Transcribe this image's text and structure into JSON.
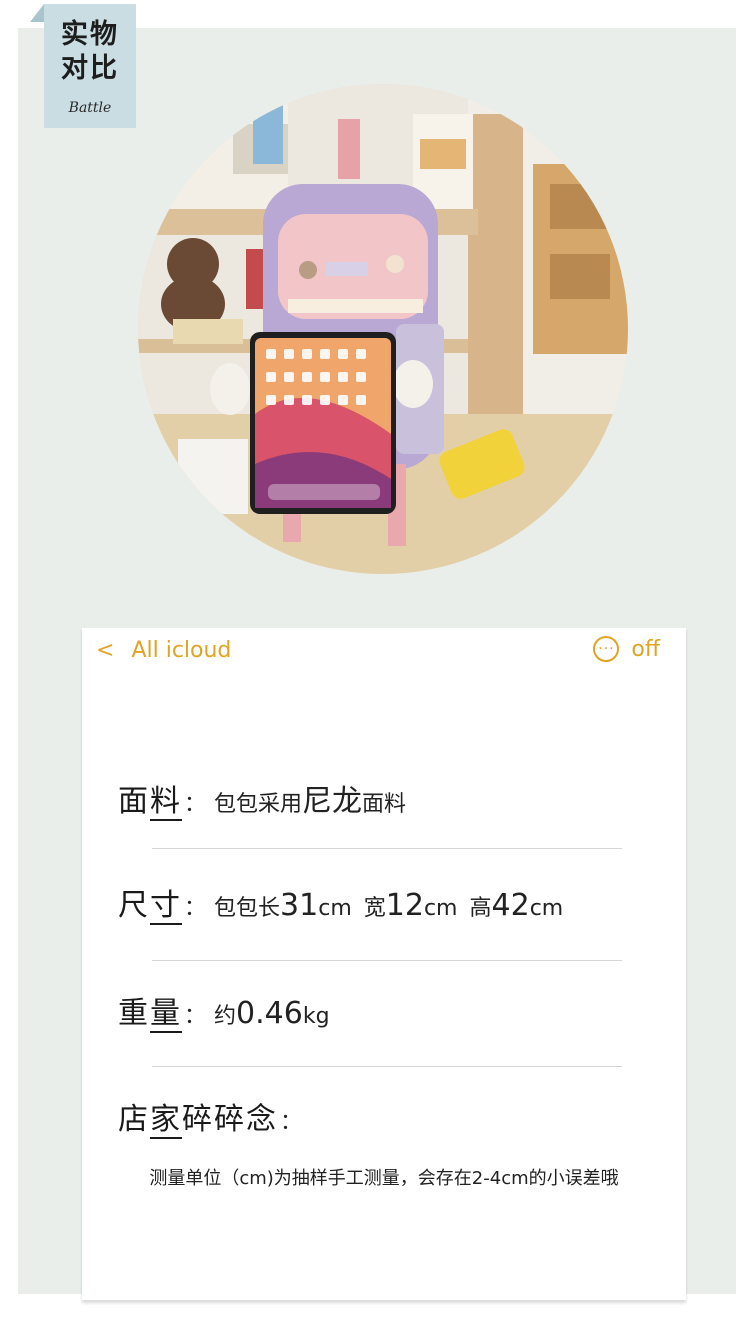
{
  "header": {
    "tag_line1": "实物",
    "tag_line2": "对比",
    "tag_en": "Battle"
  },
  "nav": {
    "back_icon": "chevron-left-icon",
    "back_glyph": "<",
    "title": "All icloud",
    "more_icon": "more-icon",
    "more_glyph": "···",
    "right_label": "off"
  },
  "specs": {
    "fabric": {
      "label_a": "面",
      "label_b": "料",
      "colon": "：",
      "text_a": "包包采用",
      "text_b": "尼龙",
      "text_c": "面料"
    },
    "size": {
      "label_a": "尺",
      "label_b": "寸",
      "colon": "：",
      "p1": "包包长",
      "v1": "31",
      "u1": "cm",
      "p2": "宽",
      "v2": "12",
      "u2": "cm",
      "p3": "高",
      "v3": "42",
      "u3": "cm"
    },
    "weight": {
      "label_a": "重",
      "label_b": "量",
      "colon": "：",
      "p": "约",
      "v": "0.46",
      "u": "kg"
    },
    "notes": {
      "label_a": "店",
      "label_b": "家",
      "label_c": "碎碎念",
      "colon": "：",
      "text": "测量单位（cm)为抽样手工测量，会存在2-4cm的小误差哦"
    }
  },
  "colors": {
    "accent": "#e0a424",
    "panel": "#e9eeeb",
    "tag": "#c9dde3"
  }
}
